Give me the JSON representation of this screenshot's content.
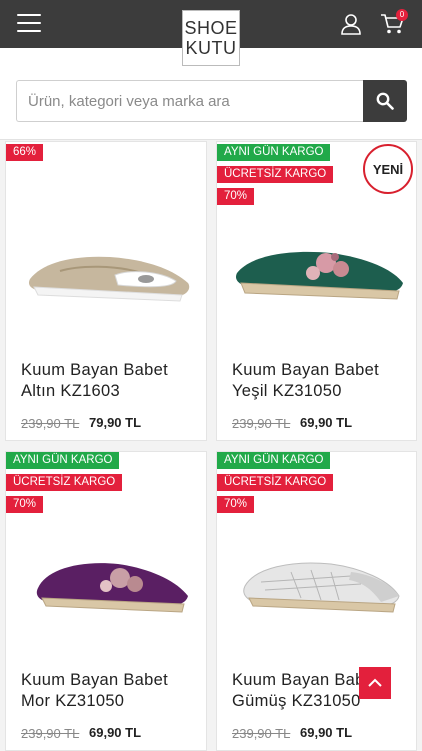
{
  "header": {
    "logo_line1": "SHOE",
    "logo_line2": "KUTU",
    "cart_count": "0"
  },
  "search": {
    "placeholder": "Ürün, kategori veya marka ara"
  },
  "products": [
    {
      "name": "Kuum Bayan Babet Altın KZ1603",
      "old_price": "239,90 TL",
      "price": "79,90 TL",
      "badges": [
        "66%"
      ]
    },
    {
      "name": "Kuum Bayan Babet Yeşil KZ31050",
      "old_price": "239,90 TL",
      "price": "69,90 TL",
      "badges": [
        "AYNI GÜN KARGO",
        "ÜCRETSİZ KARGO",
        "70%"
      ],
      "new_label": "YENİ"
    },
    {
      "name": "Kuum Bayan Babet Mor KZ31050",
      "old_price": "239,90 TL",
      "price": "69,90 TL",
      "badges": [
        "AYNI GÜN KARGO",
        "ÜCRETSİZ KARGO",
        "70%"
      ]
    },
    {
      "name": "Kuum Bayan Babet Gümüş KZ31050",
      "old_price": "239,90 TL",
      "price": "69,90 TL",
      "badges": [
        "AYNI GÜN KARGO",
        "ÜCRETSİZ KARGO",
        "70%"
      ]
    }
  ],
  "colors": {
    "topbar": "#3c3c3c",
    "badge_green": "#21a949",
    "badge_red": "#e3203c"
  }
}
